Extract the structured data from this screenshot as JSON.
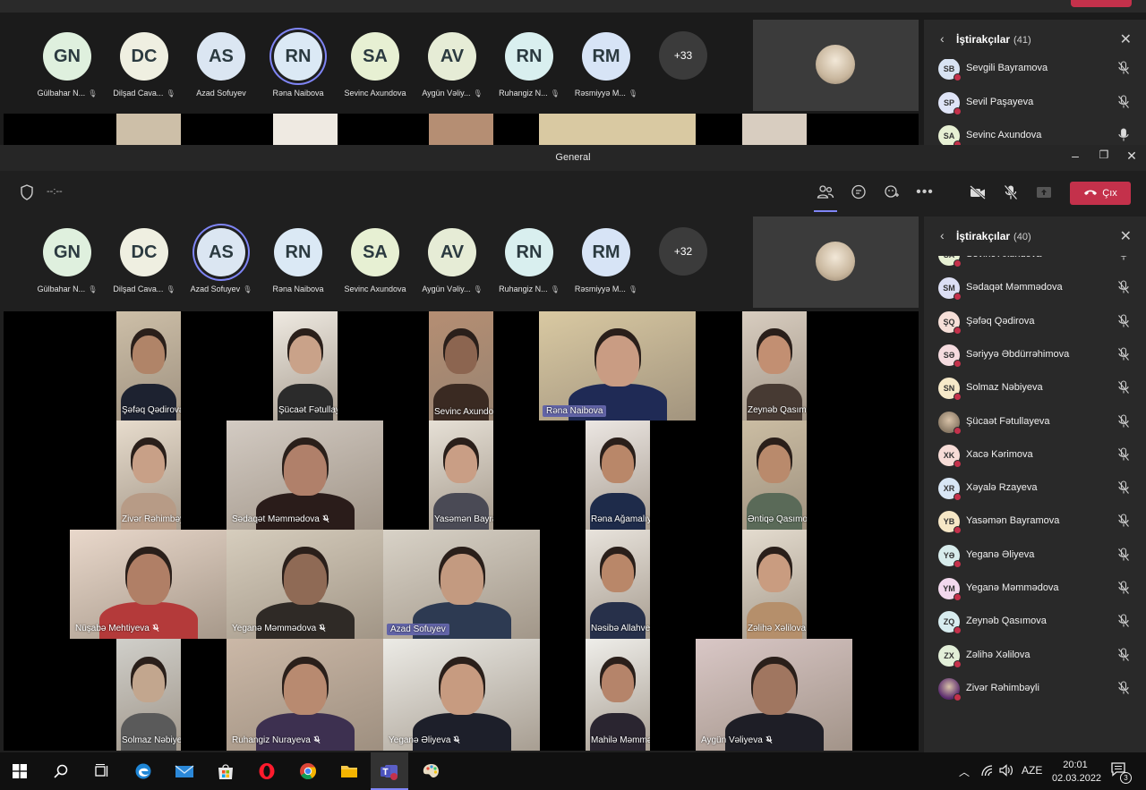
{
  "roster_top": [
    {
      "initials": "GN",
      "label": "Gülbahar N...",
      "color": "#dff0de",
      "muted": true
    },
    {
      "initials": "DC",
      "label": "Dilşad Cava...",
      "color": "#efefe1",
      "muted": true
    },
    {
      "initials": "AS",
      "label": "Azad Sofuyev",
      "color": "#dbe6f2",
      "muted": false
    },
    {
      "initials": "RN",
      "label": "Rəna Naibova",
      "color": "#dbe9f5",
      "muted": false,
      "active": true
    },
    {
      "initials": "SA",
      "label": "Sevinc Axundova",
      "color": "#e7f0d3",
      "muted": false
    },
    {
      "initials": "AV",
      "label": "Aygün Vəliy...",
      "color": "#e6ecd6",
      "muted": true
    },
    {
      "initials": "RN",
      "label": "Ruhangiz N...",
      "color": "#d9efef",
      "muted": true
    },
    {
      "initials": "RM",
      "label": "Rəsmiyyə M...",
      "color": "#d7e4f6",
      "muted": true
    }
  ],
  "roster_top_more": "+33",
  "roster_main": [
    {
      "initials": "GN",
      "label": "Gülbahar N...",
      "color": "#dff0de",
      "muted": true
    },
    {
      "initials": "DC",
      "label": "Dilşad Cava...",
      "color": "#efefe1",
      "muted": true
    },
    {
      "initials": "AS",
      "label": "Azad Sofuyev",
      "color": "#dbe6f2",
      "muted": true,
      "active": true
    },
    {
      "initials": "RN",
      "label": "Rəna Naibova",
      "color": "#dbe9f5",
      "muted": false
    },
    {
      "initials": "SA",
      "label": "Sevinc Axundova",
      "color": "#e7f0d3",
      "muted": false
    },
    {
      "initials": "AV",
      "label": "Aygün Vəliy...",
      "color": "#e6ecd6",
      "muted": true
    },
    {
      "initials": "RN",
      "label": "Ruhangiz N...",
      "color": "#d9efef",
      "muted": true
    },
    {
      "initials": "RM",
      "label": "Rəsmiyyə M...",
      "color": "#d7e4f6",
      "muted": true
    }
  ],
  "roster_main_more": "+32",
  "panel_top": {
    "title": "İştirakçılar",
    "count": "(41)",
    "rows": [
      {
        "initials": "SB",
        "name": "Sevgili Bayramova",
        "color": "#d8e3f3",
        "mic": "muted"
      },
      {
        "initials": "SP",
        "name": "Sevil Paşayeva",
        "color": "#dfe4f7",
        "mic": "muted"
      },
      {
        "initials": "SA",
        "name": "Sevinc Axundova",
        "color": "#e7f0d3",
        "mic": "on"
      }
    ]
  },
  "window_title": "General",
  "call_timer": "--:--",
  "leave_label": "Çıx",
  "panel_main": {
    "title": "İştirakçılar",
    "count": "(40)",
    "rows": [
      {
        "initials": "SA",
        "name": "Sevinc Axundova",
        "color": "#e7f0d3",
        "mic": "on"
      },
      {
        "initials": "SM",
        "name": "Sədaqət Məmmədova",
        "color": "#dcdff4",
        "mic": "muted"
      },
      {
        "initials": "ŞQ",
        "name": "Şəfəq Qədirova",
        "color": "#f6dfd8",
        "mic": "muted"
      },
      {
        "initials": "SƏ",
        "name": "Səriyyə Əbdürrəhimova",
        "color": "#f5dbdf",
        "mic": "muted"
      },
      {
        "initials": "SN",
        "name": "Solmaz Nəbiyeva",
        "color": "#f6e9c9",
        "mic": "muted"
      },
      {
        "initials": "",
        "name": "Şücaət Fətullayeva",
        "color": "#8a7a66",
        "mic": "muted",
        "photo": true
      },
      {
        "initials": "XK",
        "name": "Xacə Kərimova",
        "color": "#f7dcd7",
        "mic": "muted"
      },
      {
        "initials": "XR",
        "name": "Xəyalə Rzayeva",
        "color": "#d8e6f5",
        "mic": "muted"
      },
      {
        "initials": "YB",
        "name": "Yasəmən Bayramova",
        "color": "#f6e7c6",
        "mic": "muted"
      },
      {
        "initials": "YƏ",
        "name": "Yeganə Əliyeva",
        "color": "#d7ecec",
        "mic": "muted"
      },
      {
        "initials": "YM",
        "name": "Yeganə Məmmədova",
        "color": "#f3d9ee",
        "mic": "muted"
      },
      {
        "initials": "ZQ",
        "name": "Zeynəb Qasımova",
        "color": "#d7ecef",
        "mic": "muted"
      },
      {
        "initials": "ZX",
        "name": "Zəlihə Xəlilova",
        "color": "#e2efd8",
        "mic": "muted"
      },
      {
        "initials": "",
        "name": "Zivər Rəhimbəyli",
        "color": "#5a2a6e",
        "mic": "muted",
        "photo": true
      }
    ]
  },
  "video_tiles": [
    {
      "name": "Şəfəq Qədirova",
      "bg": "#cdbfa8",
      "skin": "#b08468",
      "cloth": "#1d2230",
      "muted": true
    },
    {
      "name": "Şücaət Fətullayeva",
      "bg": "#efeae2",
      "skin": "#c9a289",
      "cloth": "#2b2b2b",
      "muted": true
    },
    {
      "name": "Sevinc Axundova",
      "bg": "#b58e73",
      "skin": "#8c6550",
      "cloth": "#3a2a22",
      "muted": false
    },
    {
      "name": "Rəna Naibova",
      "bg": "#d9c9a2",
      "skin": "#c99c83",
      "cloth": "#1f2a55",
      "muted": false,
      "highlight": true
    },
    {
      "name": "Zeynəb Qasımova",
      "bg": "#d8cdc0",
      "skin": "#c28f72",
      "cloth": "#473a33",
      "muted": true
    },
    {
      "name": "Zivər Rəhimbəyli",
      "bg": "#e7dccd",
      "skin": "#c8a087",
      "cloth": "#b79b86",
      "muted": true
    },
    {
      "name": "Sədaqət Məmmədova",
      "bg": "#d3cbc3",
      "skin": "#b0806a",
      "cloth": "#2a1c1a",
      "muted": true
    },
    {
      "name": "Yasəmən Bayramova",
      "bg": "#e6e0d6",
      "skin": "#c99e85",
      "cloth": "#4a4a55",
      "muted": true
    },
    {
      "name": "Rəna Ağamalıyeva",
      "bg": "#ece7e3",
      "skin": "#b98769",
      "cloth": "#1e2b4a",
      "muted": true
    },
    {
      "name": "Əntiqə Qasımova",
      "bg": "#cbbda3",
      "skin": "#b98a6c",
      "cloth": "#5a6a58",
      "muted": true
    },
    {
      "name": "Nüşabə Mehtiyeva",
      "bg": "#e9d8cb",
      "skin": "#b07f66",
      "cloth": "#b43a3a",
      "muted": true
    },
    {
      "name": "Yeganə Məmmədova",
      "bg": "#d6cdbd",
      "skin": "#8f6a55",
      "cloth": "#2f2a26",
      "muted": true
    },
    {
      "name": "Azad Sofuyev",
      "bg": "#d8d2c7",
      "skin": "#c39a80",
      "cloth": "#2d3a52",
      "muted": false,
      "highlight": true
    },
    {
      "name": "Nəsibə Allahverdiyeva",
      "bg": "#e8e3dc",
      "skin": "#b98769",
      "cloth": "#27304a",
      "muted": true
    },
    {
      "name": "Zəlihə Xəlilova",
      "bg": "#e4dccf",
      "skin": "#c99c80",
      "cloth": "#b58f6b",
      "muted": true
    },
    {
      "name": "Solmaz Nəbiyeva",
      "bg": "#d0cfca",
      "skin": "#c2a68e",
      "cloth": "#5a5a5a",
      "muted": true
    },
    {
      "name": "Ruhangiz Nurayeva",
      "bg": "#cbb8a7",
      "skin": "#b88a70",
      "cloth": "#3d3050",
      "muted": true
    },
    {
      "name": "Yeganə Əliyeva",
      "bg": "#ecebe6",
      "skin": "#c79b80",
      "cloth": "#1d1f2a",
      "muted": true
    },
    {
      "name": "Mahilə Məmmədova",
      "bg": "#efeeea",
      "skin": "#b5846a",
      "cloth": "#2a2530",
      "muted": true
    },
    {
      "name": "Aygün Vəliyeva",
      "bg": "#d9c7c6",
      "skin": "#a07660",
      "cloth": "#1e1e26",
      "muted": true
    }
  ],
  "taskbar": {
    "language": "AZE",
    "time": "20:01",
    "date": "02.03.2022",
    "notification_count": "3"
  }
}
